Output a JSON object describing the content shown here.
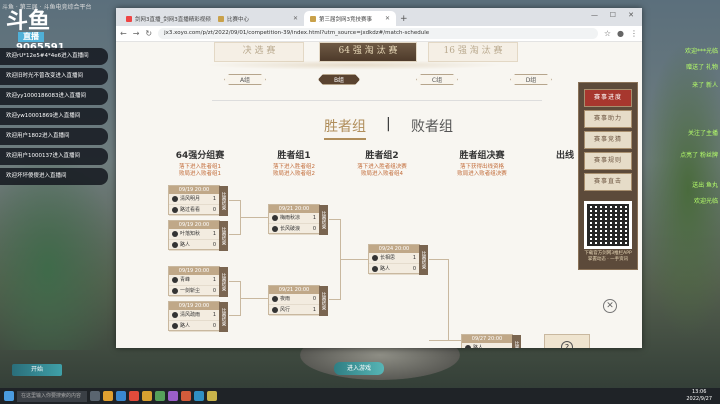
{
  "stream": {
    "top_text": "斗鱼 · 第三届 · 斗鱼电竞综合平台",
    "logo": "斗鱼",
    "logo_sub": "直播",
    "fans": "9065591",
    "chat": [
      "欢迎rU*12e5#4*4e6进入直播间",
      "欢迎旧时光不曾改变进入直播间",
      "欢迎yy1000186083进入直播间",
      "欢迎yw10001869进入直播间",
      "欢迎用户1802进入直播间",
      "欢迎用户1000137进入直播间",
      "欢迎坏坏傻傻进入直播间"
    ],
    "right_msgs": [
      "欢迎***光临",
      "赠送了 礼物",
      "来了 新人",
      "关注了主播",
      "点亮了 粉丝牌",
      "送出 鱼丸",
      "欢迎光临"
    ]
  },
  "browser": {
    "tabs": [
      {
        "label": "剑网3直播_剑网3直播精彩视频"
      },
      {
        "label": "比赛中心"
      },
      {
        "label": "第三届剑网3竞技赛事"
      }
    ],
    "new_tab": "+",
    "url": "jx3.xoyo.com/p/zt/2022/09/01/competition-39/index.html?utm_source=jxdkdz#/match-schedule"
  },
  "page": {
    "banners": [
      "决 选 赛",
      "64 强 淘 汰 赛",
      "16 强 淘 汰 赛"
    ],
    "groups": [
      "A组",
      "B组",
      "C组",
      "D组"
    ],
    "tab_win": "胜者组",
    "tab_sep": "|",
    "tab_lose": "败者组",
    "columns": [
      {
        "title": "64强分组赛",
        "sub1": "落下进入胜者组1",
        "sub2": "败局进入败者组1"
      },
      {
        "title": "胜者组1",
        "sub1": "落下进入胜者组2",
        "sub2": "败局进入败者组2"
      },
      {
        "title": "胜者组2",
        "sub1": "落下进入胜者组决赛",
        "sub2": "败局进入败者组4"
      },
      {
        "title": "胜者组决赛",
        "sub1": "落下获得出线资格",
        "sub2": "败局进入败者组决赛"
      }
    ],
    "final_head": "出线",
    "matches": [
      {
        "time": "09/19 20:00",
        "p1": "清风明月",
        "s1": "1",
        "p2": "路过看看",
        "s2": "0",
        "side": "比赛结束"
      },
      {
        "time": "09/19 20:00",
        "p1": "叶落知秋",
        "s1": "1",
        "p2": "路人",
        "s2": "0",
        "side": "比赛结束"
      },
      {
        "time": "09/19 20:00",
        "p1": "青峰",
        "s1": "1",
        "p2": "一剑斩尘",
        "s2": "0",
        "side": "比赛结束"
      },
      {
        "time": "09/19 20:00",
        "p1": "清风疏雨",
        "s1": "1",
        "p2": "路人",
        "s2": "0",
        "side": "比赛结束"
      },
      {
        "time": "09/21 20:00",
        "p1": "梅雨秋凉",
        "s1": "1",
        "p2": "长风破浪",
        "s2": "0",
        "side": "比赛结束"
      },
      {
        "time": "09/21 20:00",
        "p1": "夜雨",
        "s1": "0",
        "p2": "风行",
        "s2": "1",
        "side": "比赛结束"
      },
      {
        "time": "09/24 20:00",
        "p1": "长相思",
        "s1": "1",
        "p2": "路人",
        "s2": "0",
        "side": "比赛结束"
      },
      {
        "time": "09/27 20:00",
        "p1": "路人",
        "s1": "",
        "p2": "",
        "s2": "",
        "side": "比赛结束"
      }
    ],
    "qmark": "?"
  },
  "side_menu": {
    "items": [
      "赛事进度",
      "赛事助力",
      "赛事竞猜",
      "赛事规则",
      "赛事直击"
    ],
    "qr_caption1": "下载官方剑网3推栏APP",
    "qr_caption2": "掌握动态 · 一手资讯",
    "close": "✕"
  },
  "bottom": {
    "start": "开始",
    "game": "进入游戏"
  },
  "taskbar": {
    "search": "在这里输入你要搜索的内容",
    "time": "13:06",
    "date": "2022/9/27"
  }
}
